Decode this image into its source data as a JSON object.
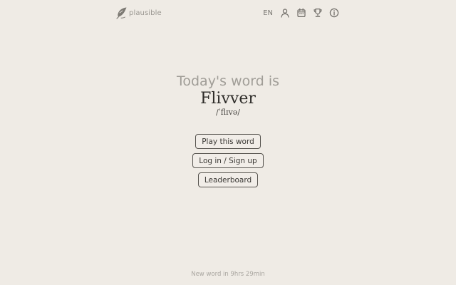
{
  "header": {
    "brand_name": "plausible",
    "brand_icon": "feather-icon",
    "language": "EN",
    "icons": [
      "user-icon",
      "calendar-icon",
      "trophy-icon",
      "info-icon"
    ]
  },
  "hero": {
    "prefix": "Today's word is",
    "word": "Flivver",
    "phonetic": "/ˈflɪvə/"
  },
  "actions": {
    "play_label": "Play this word",
    "login_label": "Log in / Sign up",
    "leaderboard_label": "Leaderboard"
  },
  "footer": {
    "next_word": "New word in 9hrs 29min"
  },
  "colors": {
    "background": "#efebe5",
    "text_dark": "#2d2b28",
    "text_muted": "#a09d97",
    "button_border": "#57544f"
  }
}
